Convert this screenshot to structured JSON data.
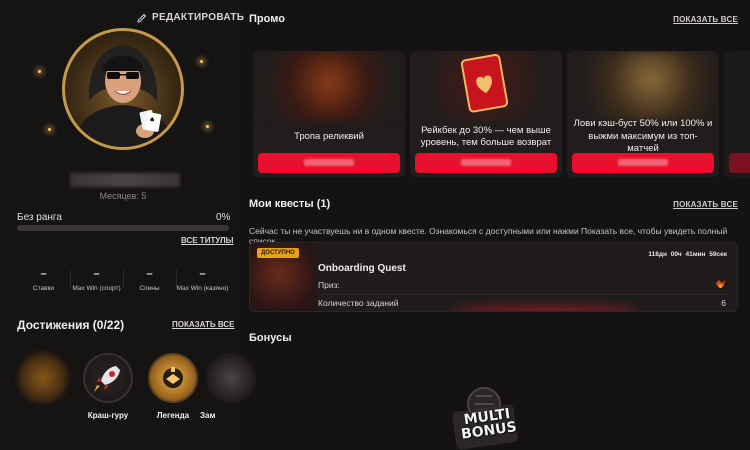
{
  "profile": {
    "edit_label": "РЕДАКТИРОВАТЬ",
    "months": "Месяцев: 5",
    "rank_label": "Без ранга",
    "rank_percent": "0%",
    "rank_progress": 0,
    "all_titles": "ВСЕ ТИТУЛЫ",
    "stats": [
      {
        "value": "–",
        "label": "Ставки"
      },
      {
        "value": "–",
        "label": "Max Win (спорт)"
      },
      {
        "value": "–",
        "label": "Спины"
      },
      {
        "value": "–",
        "label": "Max Win (казино)"
      }
    ]
  },
  "achievements": {
    "title": "Достижения (0/22)",
    "show_all": "ПОКАЗАТЬ ВСЕ",
    "items": [
      {
        "label": "",
        "icon": "blurred-badge-icon"
      },
      {
        "label": "Краш-гуру",
        "icon": "rocket-badge-icon"
      },
      {
        "label": "Легенда",
        "icon": "legend-badge-icon"
      },
      {
        "label": "Зам",
        "icon": "badge-icon"
      }
    ]
  },
  "promo": {
    "title": "Промо",
    "show_all": "ПОКАЗАТЬ ВСЕ",
    "cards": [
      {
        "text": "Тропа реликвий"
      },
      {
        "text": "Рейкбек до 30% — чем выше уровень, тем больше возврат"
      },
      {
        "text": "Лови кэш-буст 50% или 100% и выжми максимум из топ-матчей"
      }
    ]
  },
  "quests": {
    "title": "Мои квесты (1)",
    "show_all": "ПОКАЗАТЬ ВСЕ",
    "note": "Сейчас ты не участвуешь ни в одном квесте. Ознакомься с доступными или нажми Показать все, чтобы увидеть полный список.",
    "card": {
      "badge": "ДОСТУПНО",
      "name": "Onboarding Quest",
      "timer": "118дн 00ч 41мин 59сек",
      "prize_label": "Приз:",
      "tasks_label": "Количество заданий",
      "tasks_count": "6"
    }
  },
  "bonuses": {
    "title": "Бонусы",
    "logo_line1": "MULTI",
    "logo_line2": "BONUS"
  },
  "colors": {
    "accent_red": "#e8102c",
    "badge_orange": "#e8a21a",
    "background": "#141212"
  }
}
